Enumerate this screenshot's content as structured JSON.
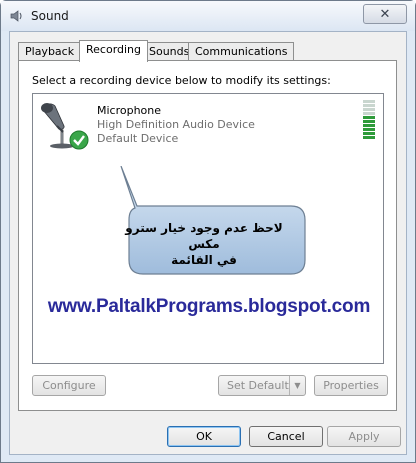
{
  "window": {
    "title": "Sound",
    "close_glyph": "✕"
  },
  "tabs": [
    {
      "label": "Playback"
    },
    {
      "label": "Recording"
    },
    {
      "label": "Sounds"
    },
    {
      "label": "Communications"
    }
  ],
  "active_tab": "Recording",
  "panel": {
    "instruction": "Select a recording device below to modify its settings:"
  },
  "device": {
    "name": "Microphone",
    "description": "High Definition Audio Device",
    "status": "Default Device",
    "icon": "microphone-icon",
    "badge_icon": "green-check-icon",
    "level_bars_total": 10,
    "level_bars_lit": 6
  },
  "callout": {
    "line1": "لاحظ عدم وجود خيار سترو مكس",
    "line2": "في القائمة"
  },
  "watermark": "www.PaltalkPrograms.blogspot.com",
  "panel_buttons": {
    "configure": "Configure",
    "set_default": "Set Default",
    "set_default_arrow": "▼",
    "properties": "Properties"
  },
  "dialog_buttons": {
    "ok": "OK",
    "cancel": "Cancel",
    "apply": "Apply"
  },
  "colors": {
    "accent": "#2a6fb2",
    "level_lit": "#2e9b3a",
    "level_unlit": "#c9d6cf",
    "watermark": "#2a2a9a",
    "callout_fill": "#b9d0e8"
  }
}
